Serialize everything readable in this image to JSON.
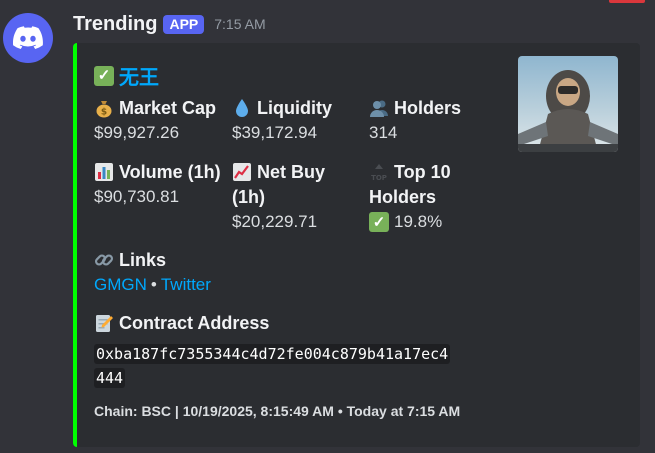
{
  "message": {
    "username": "Trending",
    "badge": "APP",
    "timestamp": "7:15 AM"
  },
  "embed": {
    "accent_color": "#00ff00",
    "title": "无王",
    "title_icon": "check-mark-icon",
    "fields": {
      "market_cap": {
        "name": "Market Cap",
        "value": "$99,927.26",
        "icon": "money-bag-icon"
      },
      "liquidity": {
        "name": "Liquidity",
        "value": "$39,172.94",
        "icon": "droplet-icon"
      },
      "holders": {
        "name": "Holders",
        "value": "314",
        "icon": "users-icon"
      },
      "volume": {
        "name": "Volume (1h)",
        "value": "$90,730.81",
        "icon": "bar-chart-icon"
      },
      "net_buy": {
        "name_line1": "Net Buy",
        "name_line2": "(1h)",
        "value": "$20,229.71",
        "icon": "chart-increasing-icon"
      },
      "top10": {
        "name_line1": "Top 10",
        "name_line2": "Holders",
        "value": "19.8%",
        "icon": "top-icon",
        "value_icon": "check-mark-icon"
      },
      "links": {
        "name": "Links",
        "icon": "link-icon",
        "items": [
          "GMGN",
          "Twitter"
        ],
        "separator": "•"
      },
      "contract": {
        "name": "Contract Address",
        "icon": "memo-icon",
        "line1": "0xba187fc7355344c4d72fe004c879b41a17ec4",
        "line2": "444"
      }
    },
    "footer": "Chain: BSC | 10/19/2025, 8:15:49 AM • Today at 7:15 AM"
  }
}
